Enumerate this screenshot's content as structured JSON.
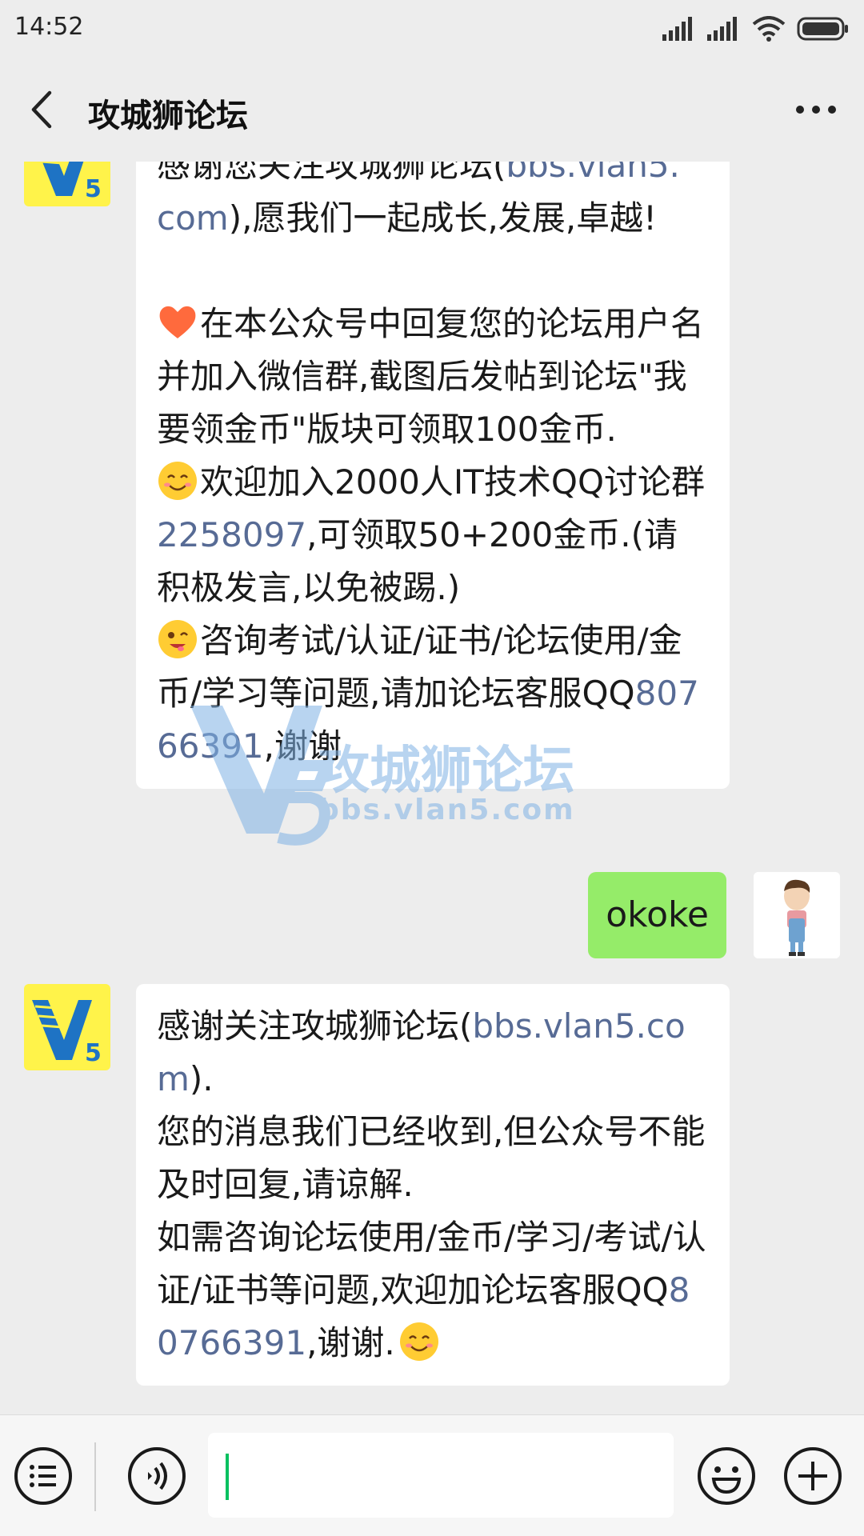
{
  "status_bar": {
    "time": "14:52"
  },
  "header": {
    "title": "攻城狮论坛"
  },
  "messages": [
    {
      "sender": "official",
      "partial_first_line": "感谢您关注攻城狮论坛(",
      "partial_first_link": "bbs.vlan5.",
      "line1_link": "com",
      "line1_rest": "),愿我们一起成长,发展,卓越!",
      "p1": "在本公众号中回复您的论坛用户名并加入微信群,截图后发帖到论坛\"我要领金币\"版块可领取100金币.",
      "p2_a": "欢迎加入2000人IT技术QQ讨论群",
      "p2_link": "2258097",
      "p2_b": ",可领取50+200金币.(请积极发言,以免被踢.)",
      "p3_a": "咨询考试/认证/证书/论坛使用/金币/学习等问题,请加论坛客服QQ",
      "p3_link": "80766391",
      "p3_b": ",谢谢"
    },
    {
      "sender": "me",
      "text": "okoke"
    },
    {
      "sender": "official",
      "a": "感谢关注攻城狮论坛(",
      "link1": "bbs.vlan5.com",
      "b": ").",
      "c": "您的消息我们已经收到,但公众号不能及时回复,请谅解.",
      "d": "如需咨询论坛使用/金币/学习/考试/认证/证书等问题,欢迎加论坛客服QQ",
      "link2": "80766391",
      "e": ",谢谢."
    }
  ],
  "watermark": {
    "title": "攻城狮论坛",
    "url": "bbs.vlan5.com"
  },
  "avatar_official": {
    "text": "V5"
  },
  "colors": {
    "link": "#576b95",
    "my_bubble": "#95ec69",
    "caret": "#07c160"
  },
  "input": {
    "value": ""
  }
}
